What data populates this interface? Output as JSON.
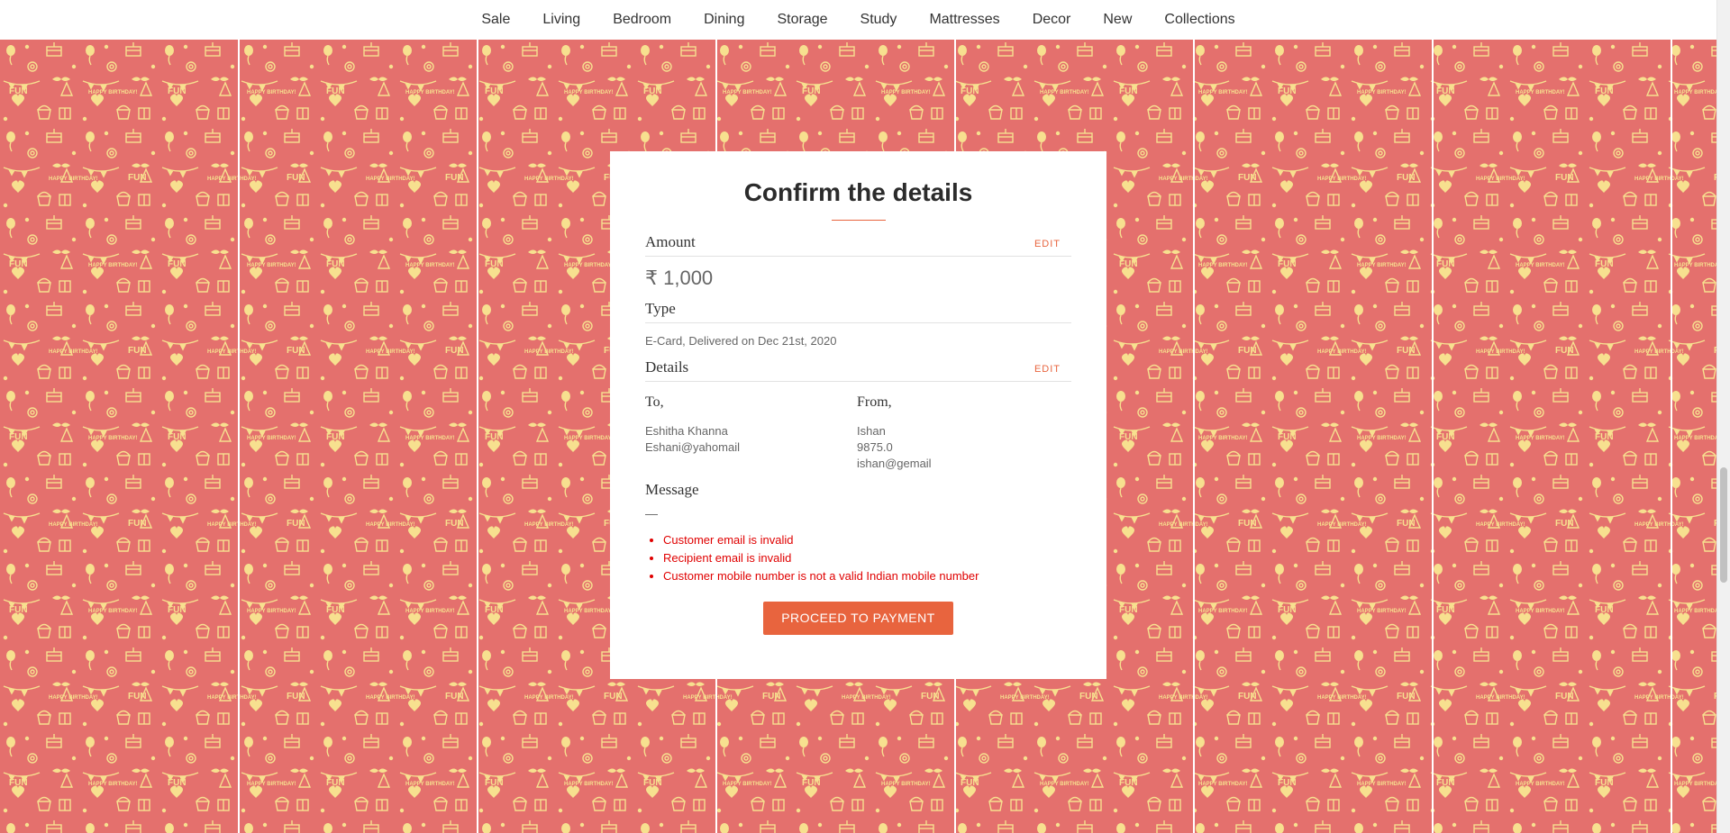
{
  "colors": {
    "accent": "#e8643e",
    "background": "#e4706d",
    "pattern": "#f7e08f",
    "error": "#e00000"
  },
  "nav": {
    "items": [
      "Sale",
      "Living",
      "Bedroom",
      "Dining",
      "Storage",
      "Study",
      "Mattresses",
      "Decor",
      "New",
      "Collections"
    ]
  },
  "pattern_text": {
    "fun": "FUN",
    "birthday": "HAPPY BIRTHDAY!"
  },
  "card": {
    "title": "Confirm the details",
    "amount": {
      "label": "Amount",
      "edit": "EDIT",
      "value": "₹ 1,000"
    },
    "type": {
      "label": "Type",
      "value": "E-Card, Delivered on Dec 21st, 2020"
    },
    "details": {
      "label": "Details",
      "edit": "EDIT",
      "to": {
        "heading": "To,",
        "name": "Eshitha Khanna",
        "email": "Eshani@yahomail"
      },
      "from": {
        "heading": "From,",
        "name": "Ishan",
        "phone": "9875.0",
        "email": "ishan@gemail"
      }
    },
    "message": {
      "label": "Message",
      "value": "—"
    },
    "errors": [
      "Customer email is invalid",
      "Recipient email is invalid",
      "Customer mobile number is not a valid Indian mobile number"
    ],
    "proceed_label": "PROCEED TO PAYMENT"
  }
}
